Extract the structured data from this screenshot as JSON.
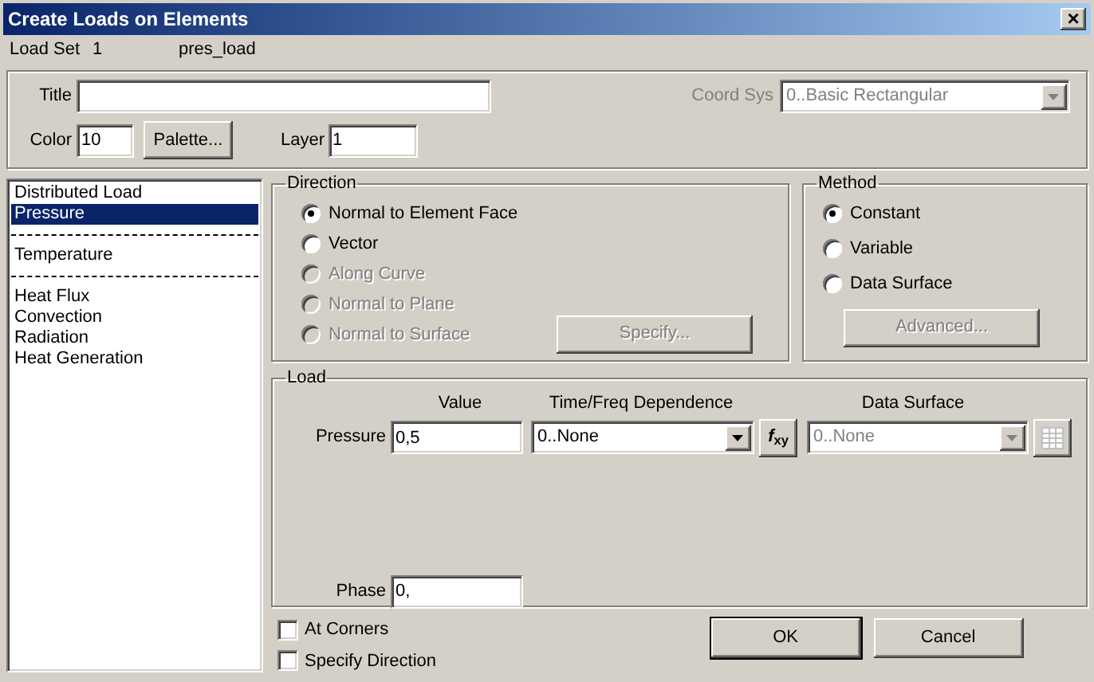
{
  "window": {
    "title": "Create Loads on Elements",
    "close": "×"
  },
  "load_set": {
    "label": "Load Set",
    "number": "1",
    "name": "pres_load"
  },
  "header": {
    "title_label": "Title",
    "color_label": "Color",
    "color_value": "10",
    "palette_button": "Palette...",
    "layer_label": "Layer",
    "layer_value": "1",
    "coord_sys_label": "Coord Sys",
    "coord_sys_value": "0..Basic Rectangular",
    "coord_sys_disabled": true
  },
  "load_types": [
    {
      "kind": "item",
      "label": "Distributed Load",
      "selected": false
    },
    {
      "kind": "item",
      "label": "Pressure",
      "selected": true
    },
    {
      "kind": "separator"
    },
    {
      "kind": "item",
      "label": "Temperature",
      "selected": false
    },
    {
      "kind": "separator"
    },
    {
      "kind": "item",
      "label": "Heat Flux",
      "selected": false
    },
    {
      "kind": "item",
      "label": "Convection",
      "selected": false
    },
    {
      "kind": "item",
      "label": "Radiation",
      "selected": false
    },
    {
      "kind": "item",
      "label": "Heat Generation",
      "selected": false
    }
  ],
  "direction": {
    "title": "Direction",
    "options": [
      {
        "label": "Normal to Element Face",
        "selected": true,
        "disabled": false
      },
      {
        "label": "Vector",
        "selected": false,
        "disabled": false
      },
      {
        "label": "Along Curve",
        "selected": false,
        "disabled": true
      },
      {
        "label": "Normal to Plane",
        "selected": false,
        "disabled": true
      },
      {
        "label": "Normal to Surface",
        "selected": false,
        "disabled": true
      }
    ],
    "specify_button": {
      "label": "Specify...",
      "disabled": true
    }
  },
  "method": {
    "title": "Method",
    "options": [
      {
        "label": "Constant",
        "selected": true
      },
      {
        "label": "Variable",
        "selected": false
      },
      {
        "label": "Data Surface",
        "selected": false
      }
    ],
    "advanced_button": {
      "label": "Advanced...",
      "disabled": true
    }
  },
  "load": {
    "title": "Load",
    "columns": [
      "Value",
      "Time/Freq Dependence",
      "Data Surface"
    ],
    "pressure_label": "Pressure",
    "pressure_value": "0,5",
    "time_dependence": "0..None",
    "function_button": "*f*$_{xy}$",
    "data_surface": "0..None",
    "data_surface_disabled": true,
    "phase_label": "Phase",
    "phase_value": "0,"
  },
  "options": [
    {
      "label": "At Corners",
      "checked": false
    },
    {
      "label": "Specify Direction",
      "checked": false
    }
  ],
  "buttons": [
    {
      "label": "OK",
      "default": true
    },
    {
      "label": "Cancel",
      "default": false
    }
  ]
}
